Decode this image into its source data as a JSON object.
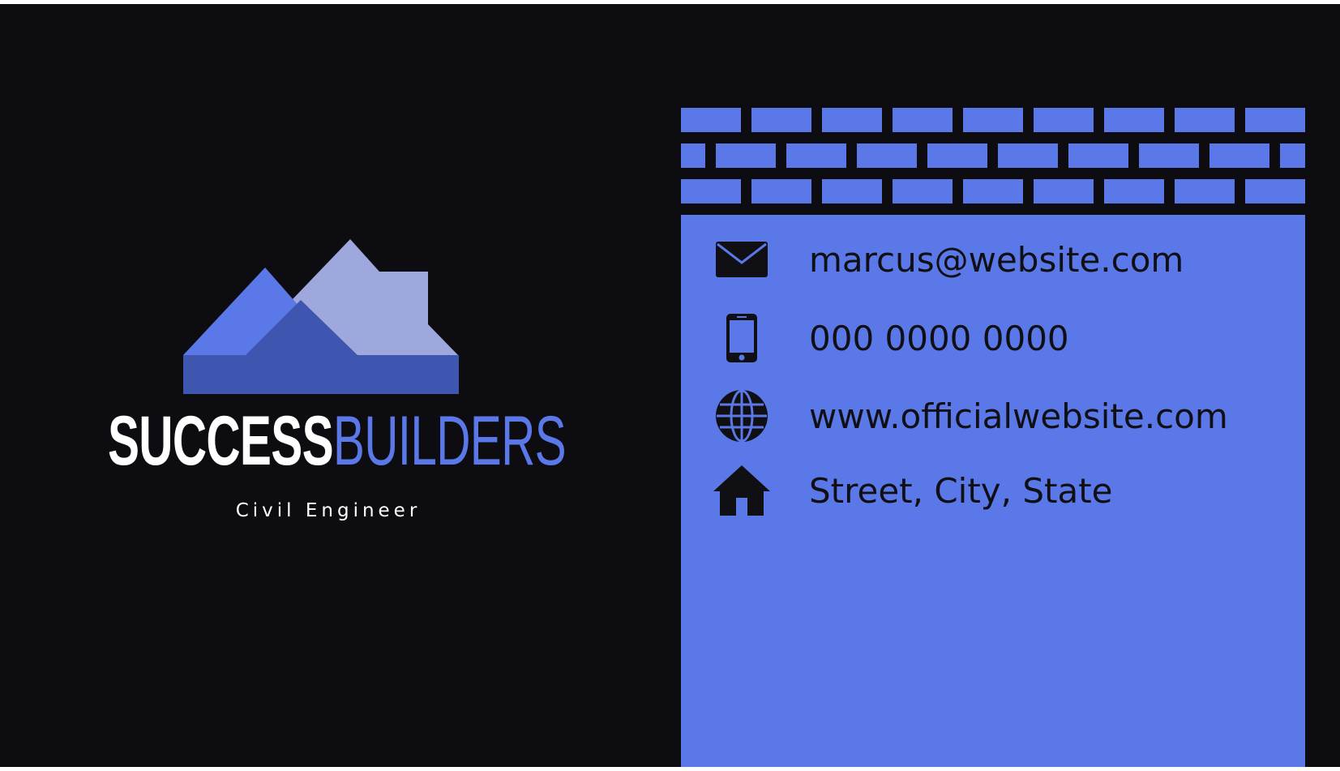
{
  "brand": {
    "name_part1": "SUCCESS",
    "name_part2": "BUILDERS",
    "role": "Civil Engineer"
  },
  "contact": {
    "email": "marcus@website.com",
    "phone": "000 0000 0000",
    "website": "www.officialwebsite.com",
    "address": "Street, City, State"
  },
  "icons": {
    "logo": "mountain-house-logo",
    "email": "envelope-icon",
    "phone": "mobile-phone-icon",
    "website": "globe-icon",
    "address": "house-icon"
  },
  "colors": {
    "background": "#0d0d11",
    "accent": "#5b78e8",
    "accent_dark": "#3e56b0",
    "accent_light": "#9ea8dc",
    "text_dark": "#0f0f14",
    "text_light": "#ffffff"
  }
}
